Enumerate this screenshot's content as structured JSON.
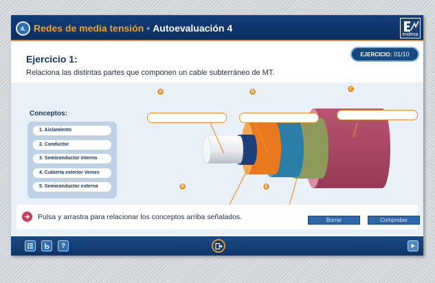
{
  "header": {
    "module_number": "4.",
    "course_title": "Redes de media tensión",
    "separator": "•",
    "section_title": "Autoevaluación 4",
    "logo_text": "endesa"
  },
  "exercise": {
    "title": "Ejercicio 1:",
    "instruction": "Relaciona las distintas partes que componen un cable subterráneo de MT.",
    "counter_label": "EJERCICIO:",
    "counter_value": "01/10"
  },
  "concepts": {
    "title": "Conceptos:",
    "items": [
      {
        "label": "1. Aislamiento"
      },
      {
        "label": "2. Conductor"
      },
      {
        "label": "3. Semiconductor interno"
      },
      {
        "label": "4. Cubierta exterior Vemex"
      },
      {
        "label": "5. Semiconductor externa"
      }
    ]
  },
  "drop_targets": [
    {
      "marker": "A"
    },
    {
      "marker": "B"
    },
    {
      "marker": "C"
    },
    {
      "marker": "D"
    },
    {
      "marker": "E"
    }
  ],
  "hint": {
    "text": "Pulsa y arrastra para relacionar los conceptos arriba señalados.",
    "icon": "arrow-right-icon"
  },
  "buttons": {
    "clear_label": "Borrar",
    "check_label": "Comprobar"
  },
  "footer": {
    "index_icon": "list-icon",
    "glossary_icon": "glossary-icon",
    "help_label": "?",
    "exit_icon": "exit-icon",
    "next_icon": "play-icon"
  },
  "colors": {
    "header_bg": "#133e78",
    "accent_orange": "#e98c1f",
    "outer_jacket": "#a8445f",
    "semiconductor_outer": "#8e9a5c",
    "insulation": "#2a7ea8",
    "semiconductor_inner": "#e8791e",
    "conductor": "#1c3f7a"
  }
}
